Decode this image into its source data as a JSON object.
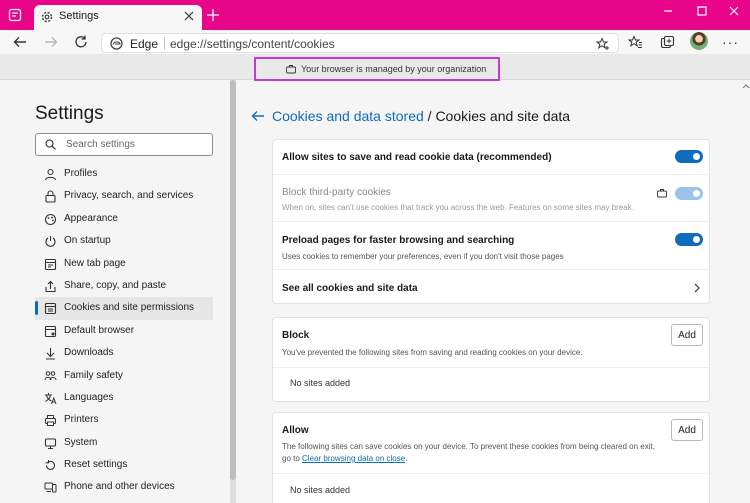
{
  "browser": {
    "tab_title": "Settings",
    "omnibox_name": "Edge",
    "url": "edge://settings/content/cookies",
    "accent_color": "#e8058a"
  },
  "banner": {
    "text": "Your browser is managed by your organization"
  },
  "sidebar": {
    "title": "Settings",
    "search_placeholder": "Search settings",
    "items": [
      {
        "label": "Profiles",
        "icon": "profile-icon"
      },
      {
        "label": "Privacy, search, and services",
        "icon": "lock-icon"
      },
      {
        "label": "Appearance",
        "icon": "appearance-icon"
      },
      {
        "label": "On startup",
        "icon": "power-icon"
      },
      {
        "label": "New tab page",
        "icon": "new-tab-icon"
      },
      {
        "label": "Share, copy, and paste",
        "icon": "share-icon"
      },
      {
        "label": "Cookies and site permissions",
        "icon": "cookies-icon",
        "active": true
      },
      {
        "label": "Default browser",
        "icon": "browser-icon"
      },
      {
        "label": "Downloads",
        "icon": "download-icon"
      },
      {
        "label": "Family safety",
        "icon": "family-icon"
      },
      {
        "label": "Languages",
        "icon": "language-icon"
      },
      {
        "label": "Printers",
        "icon": "printer-icon"
      },
      {
        "label": "System",
        "icon": "system-icon"
      },
      {
        "label": "Reset settings",
        "icon": "reset-icon"
      },
      {
        "label": "Phone and other devices",
        "icon": "phone-icon"
      }
    ]
  },
  "breadcrumb": {
    "parent": "Cookies and data stored",
    "separator": "/",
    "current": "Cookies and site data"
  },
  "settings": {
    "allow_cookies": {
      "title": "Allow sites to save and read cookie data (recommended)",
      "enabled": true
    },
    "block_third_party": {
      "title": "Block third-party cookies",
      "description": "When on, sites can't use cookies that track you across the web. Features on some sites may break.",
      "enabled": true,
      "managed": true
    },
    "preload": {
      "title": "Preload pages for faster browsing and searching",
      "description": "Uses cookies to remember your preferences, even if you don't visit those pages",
      "enabled": true
    },
    "see_all": {
      "title": "See all cookies and site data"
    }
  },
  "block": {
    "title": "Block",
    "description": "You've prevented the following sites from saving and reading cookies on your device.",
    "add_label": "Add",
    "empty_text": "No sites added"
  },
  "allow": {
    "title": "Allow",
    "description_1": "The following sites can save cookies on your device. To prevent these cookies from being cleared on exit,",
    "description_2": "go to",
    "link": "Clear browsing data on close",
    "description_end": ".",
    "add_label": "Add",
    "empty_text": "No sites added"
  }
}
